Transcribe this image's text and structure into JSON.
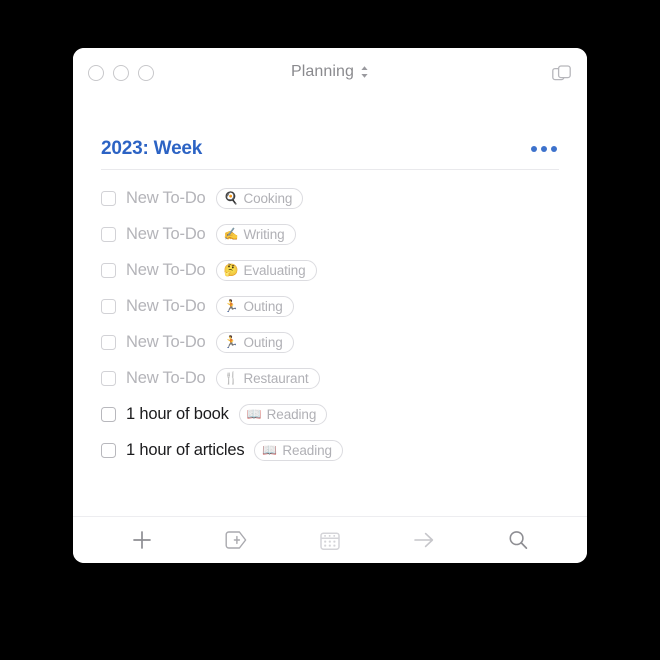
{
  "window": {
    "title": "Planning",
    "title_chevron_icon": "chevron-up-down-icon",
    "panels_icon": "overlapping-panels-icon",
    "traffic_lights": [
      "close-button",
      "minimize-button",
      "zoom-button"
    ]
  },
  "list": {
    "heading": "2023: Week",
    "heading_color": "#2c63c4",
    "more_button_icon": "ellipsis-icon",
    "tasks": [
      {
        "label": "New To-Do",
        "checked": false,
        "dimmed": true,
        "tag": {
          "emoji": "🍳",
          "emoji_name": "cooking-pan-emoji",
          "label": "Cooking"
        }
      },
      {
        "label": "New To-Do",
        "checked": false,
        "dimmed": true,
        "tag": {
          "emoji": "✍️",
          "emoji_name": "writing-hand-emoji",
          "label": "Writing"
        }
      },
      {
        "label": "New To-Do",
        "checked": false,
        "dimmed": true,
        "tag": {
          "emoji": "🤔",
          "emoji_name": "thinking-face-emoji",
          "label": "Evaluating"
        }
      },
      {
        "label": "New To-Do",
        "checked": false,
        "dimmed": true,
        "tag": {
          "emoji": "🏃",
          "emoji_name": "running-person-emoji",
          "label": "Outing"
        }
      },
      {
        "label": "New To-Do",
        "checked": false,
        "dimmed": true,
        "tag": {
          "emoji": "🏃",
          "emoji_name": "running-person-emoji",
          "label": "Outing"
        }
      },
      {
        "label": "New To-Do",
        "checked": false,
        "dimmed": true,
        "tag": {
          "emoji": "🍴",
          "emoji_name": "fork-and-knife-emoji",
          "label": "Restaurant"
        }
      },
      {
        "label": "1 hour of book",
        "checked": false,
        "dimmed": false,
        "tag": {
          "emoji": "📖",
          "emoji_name": "open-book-emoji",
          "label": "Reading"
        }
      },
      {
        "label": "1 hour of articles",
        "checked": false,
        "dimmed": false,
        "tag": {
          "emoji": "📖",
          "emoji_name": "open-book-emoji",
          "label": "Reading"
        }
      }
    ]
  },
  "toolbar": {
    "buttons": [
      {
        "name": "add-task-button",
        "icon": "plus-icon"
      },
      {
        "name": "add-tag-button",
        "icon": "tag-plus-icon"
      },
      {
        "name": "calendar-button",
        "icon": "calendar-icon"
      },
      {
        "name": "move-forward-button",
        "icon": "arrow-right-icon"
      },
      {
        "name": "search-button",
        "icon": "search-icon"
      }
    ]
  }
}
